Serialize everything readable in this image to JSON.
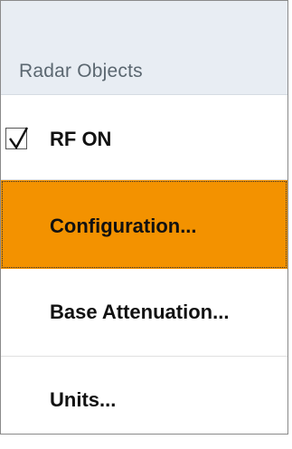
{
  "menu": {
    "header_title": "Radar Objects",
    "items": [
      {
        "label": "RF ON",
        "checked": true,
        "icon": "checkbox-checked-icon"
      },
      {
        "label": "Configuration...",
        "highlighted": true
      },
      {
        "label": "Base Attenuation..."
      },
      {
        "label": "Units..."
      }
    ]
  },
  "colors": {
    "header_bg": "#e8edf3",
    "highlight_bg": "#f39200",
    "header_text": "#5b6770",
    "item_text": "#111111"
  }
}
